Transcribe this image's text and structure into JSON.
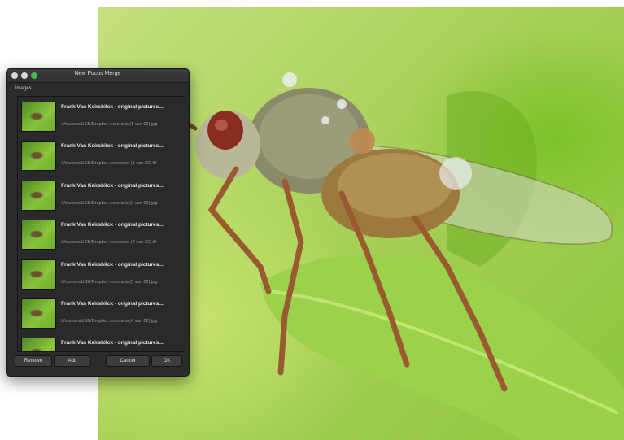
{
  "window": {
    "title": "New Focus Merge",
    "section_label": "Images"
  },
  "images": [
    {
      "title": "Frank Van Keirsbilck -  original pictures...",
      "path": "/Volumes/USB/Dropbo...ercoraria (1 van 62).jpg"
    },
    {
      "title": "Frank Van Keirsbilck -  original pictures...",
      "path": "/Volumes/USB/Dropbo...tercoraria (1 van 62).tif"
    },
    {
      "title": "Frank Van Keirsbilck -  original pictures...",
      "path": "/Volumes/USB/Dropbo...ercoraria (2 van 62).jpg"
    },
    {
      "title": "Frank Van Keirsbilck -  original pictures...",
      "path": "/Volumes/USB/Dropbo...tercoraria (2 van 62).tif"
    },
    {
      "title": "Frank Van Keirsbilck -  original pictures...",
      "path": "/Volumes/USB/Dropbo...ercoraria (3 van 62).jpg"
    },
    {
      "title": "Frank Van Keirsbilck -  original pictures...",
      "path": "/Volumes/USB/Dropbo...ercoraria (4 van 62).jpg"
    },
    {
      "title": "Frank Van Keirsbilck -  original pictures...",
      "path": ""
    }
  ],
  "buttons": {
    "remove": "Remove",
    "add": "Add",
    "cancel": "Cancel",
    "ok": "OK"
  },
  "icons": {
    "close": "close-dot-icon",
    "minimize": "minimize-dot-icon",
    "zoom": "zoom-dot-icon"
  },
  "colors": {
    "dialog_bg": "#2b2b2d",
    "zoom_green": "#3fbd4a",
    "photo_green": "#8cc63c"
  }
}
